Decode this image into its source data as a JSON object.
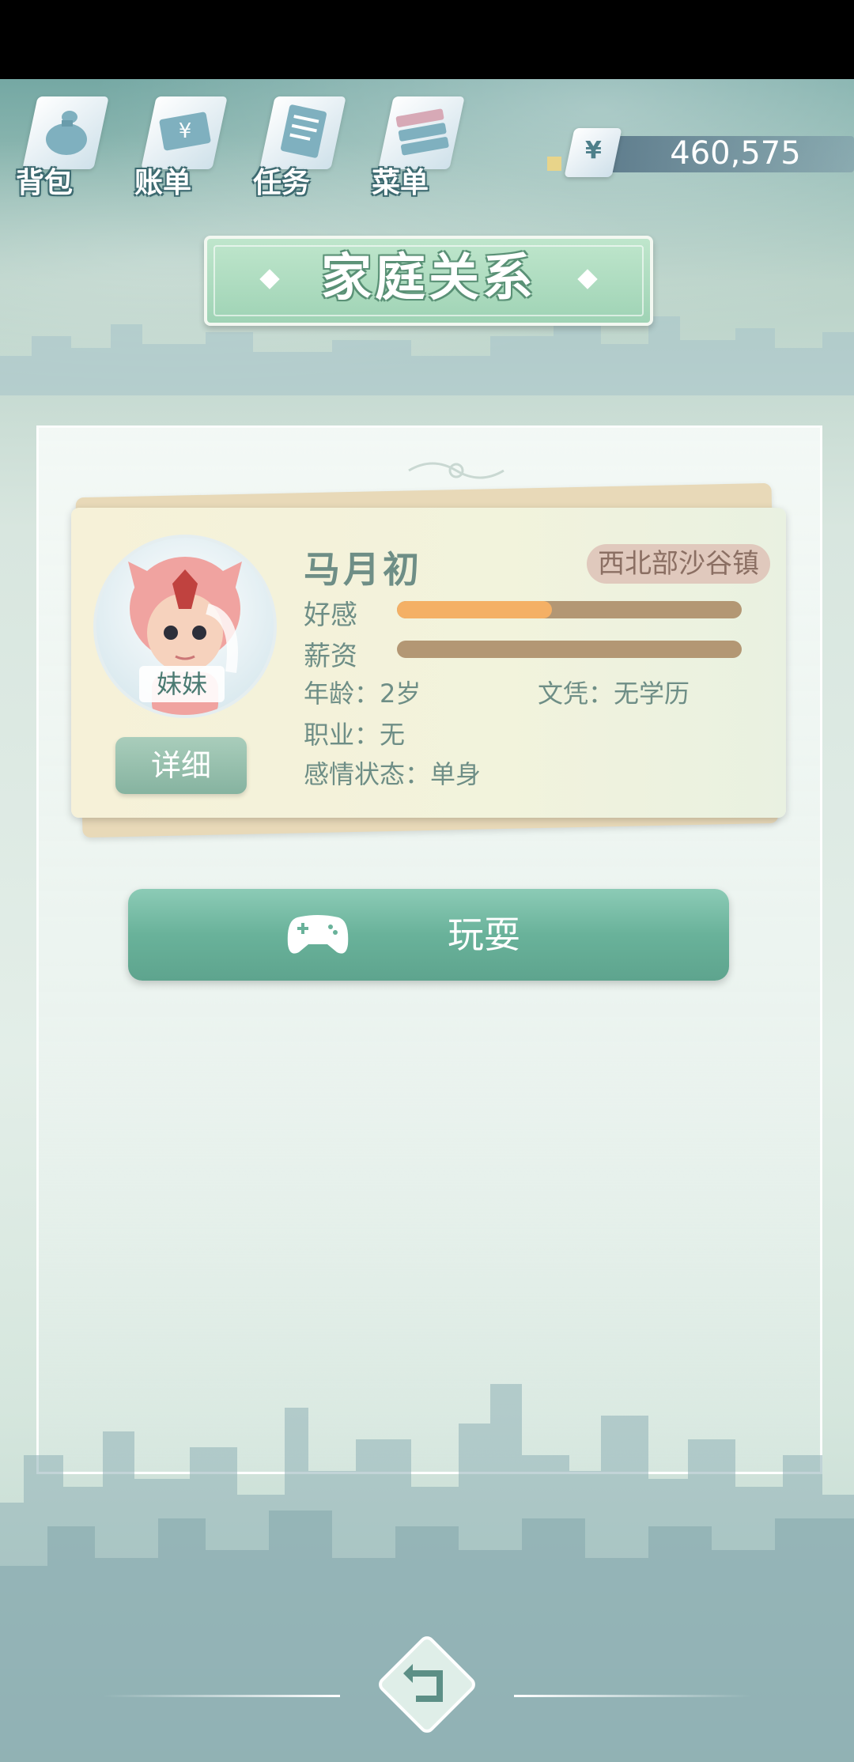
{
  "nav": {
    "items": [
      {
        "label": "背包",
        "icon": "bag-icon"
      },
      {
        "label": "账单",
        "icon": "bill-icon"
      },
      {
        "label": "任务",
        "icon": "task-icon"
      },
      {
        "label": "菜单",
        "icon": "menu-icon"
      }
    ]
  },
  "currency": {
    "symbol": "¥",
    "value": "460,575"
  },
  "title": "家庭关系",
  "member": {
    "name": "马月初",
    "location": "西北部沙谷镇",
    "relation": "妹妹",
    "detail_label": "详细",
    "affection_label": "好感",
    "affection_level": 0.45,
    "salary_label": "薪资",
    "salary_level": 0.0,
    "age": "年龄：2岁",
    "education": "文凭：无学历",
    "job": "职业：无",
    "relationship": "感情状态：单身"
  },
  "play_button": {
    "label": "玩耍",
    "icon": "gamepad-icon"
  },
  "back_button": {
    "icon": "back-arrow-icon"
  },
  "colors": {
    "accent": "#69b29a",
    "affection": "#f4b065",
    "bar_bg": "#b39774"
  }
}
